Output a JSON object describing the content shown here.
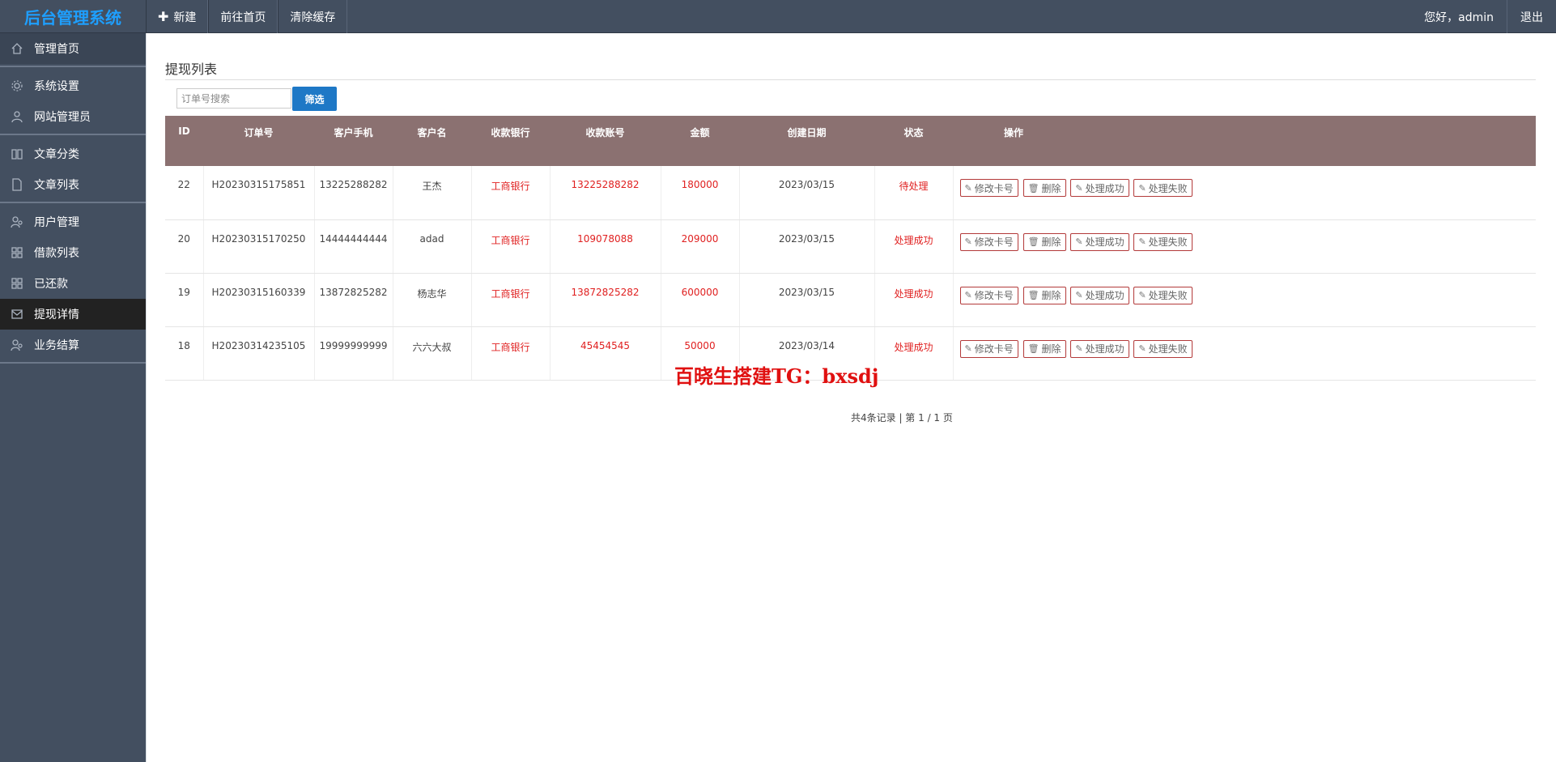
{
  "app": {
    "brand": "后台管理系统"
  },
  "topnav": [
    {
      "label": "新建",
      "icon": "plus-icon"
    },
    {
      "label": "前往首页"
    },
    {
      "label": "清除缓存"
    }
  ],
  "user": {
    "greeting": "您好，admin",
    "logout": "退出"
  },
  "sidebar": {
    "items": [
      {
        "label": "管理首页",
        "icon": "home-icon",
        "state": "home"
      },
      {
        "label": "系统设置",
        "icon": "gear-icon"
      },
      {
        "label": "网站管理员",
        "icon": "user-icon"
      },
      {
        "label": "文章分类",
        "icon": "book-icon"
      },
      {
        "label": "文章列表",
        "icon": "file-icon"
      },
      {
        "label": "用户管理",
        "icon": "users-icon"
      },
      {
        "label": "借款列表",
        "icon": "grid-icon"
      },
      {
        "label": "已还款",
        "icon": "grid-icon"
      },
      {
        "label": "提现详情",
        "icon": "envelope-icon",
        "state": "active"
      },
      {
        "label": "业务结算",
        "icon": "users-icon"
      }
    ]
  },
  "main": {
    "title": "提现列表",
    "search": {
      "placeholder": "订单号搜索",
      "value": ""
    },
    "filter_label": "筛选",
    "columns": [
      "ID",
      "订单号",
      "客户手机",
      "客户名",
      "收款银行",
      "收款账号",
      "金额",
      "创建日期",
      "状态",
      "操作"
    ],
    "rows": [
      {
        "id": "22",
        "order": "H20230315175851",
        "phone": "13225288282",
        "name": "王杰",
        "bank": "工商银行",
        "account": "13225288282",
        "amount": "180000",
        "date": "2023/03/15",
        "status": "待处理"
      },
      {
        "id": "20",
        "order": "H20230315170250",
        "phone": "14444444444",
        "name": "adad",
        "bank": "工商银行",
        "account": "109078088",
        "amount": "209000",
        "date": "2023/03/15",
        "status": "处理成功"
      },
      {
        "id": "19",
        "order": "H20230315160339",
        "phone": "13872825282",
        "name": "杨志华",
        "bank": "工商银行",
        "account": "13872825282",
        "amount": "600000",
        "date": "2023/03/15",
        "status": "处理成功"
      },
      {
        "id": "18",
        "order": "H20230314235105",
        "phone": "19999999999",
        "name": "六六大叔",
        "bank": "工商银行",
        "account": "45454545",
        "amount": "50000",
        "date": "2023/03/14",
        "status": "处理成功"
      }
    ],
    "actions": [
      {
        "label": "修改卡号",
        "icon": "edit-icon"
      },
      {
        "label": "删除",
        "icon": "trash-icon"
      },
      {
        "label": "处理成功",
        "icon": "edit-icon"
      },
      {
        "label": "处理失败",
        "icon": "edit-icon"
      }
    ],
    "watermark": "百晓生搭建TG：bxsdj",
    "pager": "共4条记录 | 第 1 / 1 页"
  },
  "colors": {
    "brand": "#1e9fff",
    "bar": "#434f60",
    "header": "#8b7171",
    "accent": "#e02020",
    "button": "#1e78c6"
  }
}
